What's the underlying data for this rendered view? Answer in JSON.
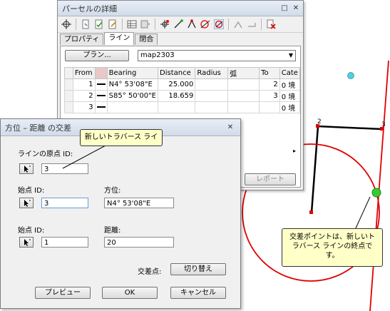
{
  "colors": {
    "curve": "#e00000",
    "traverse": "#000000",
    "endpoint": "#33cc33",
    "cyan_point": "#4dd0e1",
    "callout": "#ffffc8"
  },
  "parcel_window": {
    "title": "パーセルの詳細",
    "tabs": [
      "プロパティ",
      "ライン",
      "閉合"
    ],
    "plan_button": "プラン...",
    "plan_value": "map2303",
    "report_button": "レポート",
    "columns": [
      "From",
      "",
      "Bearing",
      "Distance",
      "Radius",
      "弧",
      "To",
      "Cate"
    ],
    "rows": [
      {
        "from": "1",
        "bearing": "N4° 53'08\"E",
        "distance": "25.000",
        "radius": "",
        "arc": "",
        "to": "2",
        "cate": "0 境"
      },
      {
        "from": "2",
        "bearing": "S85° 50'00\"E",
        "distance": "18.659",
        "radius": "",
        "arc": "",
        "to": "3",
        "cate": "0 境"
      },
      {
        "from": "3",
        "bearing": "",
        "distance": "",
        "radius": "",
        "arc": "",
        "to": "",
        "cate": "0 境"
      }
    ]
  },
  "dialog": {
    "title": "方位 – 距離 の交差",
    "line_origin_label": "ラインの原点 ID:",
    "line_origin_value": "3",
    "start1_label": "始点 ID:",
    "start1_value": "3",
    "bearing_label": "方位:",
    "bearing_value": "N4° 53'08\"E",
    "start2_label": "始点 ID:",
    "start2_value": "1",
    "distance_label": "距離:",
    "distance_value": "20",
    "intersection_label": "交差点:",
    "toggle_button": "切り替え",
    "preview_button": "プレビュー",
    "ok_button": "OK",
    "cancel_button": "キャンセル"
  },
  "callouts": {
    "new_traverse": "新しいトラバース ライ",
    "endpoint_note": "交差ポイントは、新しいトラバース ラインの終点です。"
  },
  "map_labels": {
    "point2": "2",
    "point3": "3"
  }
}
